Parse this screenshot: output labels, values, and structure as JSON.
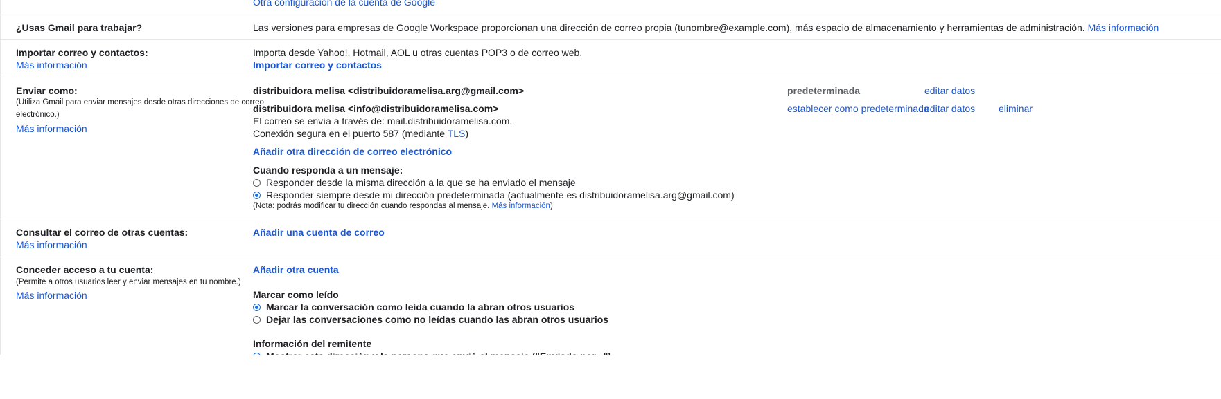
{
  "top_link": "Otra configuración de la cuenta de Google",
  "workspace": {
    "label": "¿Usas Gmail para trabajar?",
    "text": "Las versiones para empresas de Google Workspace proporcionan una dirección de correo propia (tunombre@example.com), más espacio de almacenamiento y herramientas de administración.",
    "more": "Más información"
  },
  "import": {
    "label": "Importar correo y contactos:",
    "more": "Más información",
    "text": "Importa desde Yahoo!, Hotmail, AOL u otras cuentas POP3 o de correo web.",
    "action": "Importar correo y contactos"
  },
  "send_as": {
    "label": "Enviar como:",
    "desc_line1": "(Utiliza Gmail para enviar mensajes desde otras direcciones de correo",
    "desc_line2": "electrónico.)",
    "more": "Más información",
    "addresses": [
      {
        "name": "distribuidora melisa <distribuidoramelisa.arg@gmail.com>",
        "status": "predeterminada",
        "edit": "editar datos"
      },
      {
        "name": "distribuidora melisa <info@distribuidoramelisa.com>",
        "set_default": "establecer como predeterminada",
        "edit": "editar datos",
        "delete": "eliminar",
        "server_line": "El correo se envía a través de: mail.distribuidoramelisa.com.",
        "secure_prefix": "Conexión segura en el puerto 587 (mediante ",
        "secure_link": "TLS",
        "secure_suffix": ")"
      }
    ],
    "add_address": "Añadir otra dirección de correo electrónico",
    "reply_heading": "Cuando responda a un mensaje:",
    "reply_options": [
      {
        "label": "Responder desde la misma dirección a la que se ha enviado el mensaje",
        "selected": false
      },
      {
        "label": "Responder siempre desde mi dirección predeterminada (actualmente es distribuidoramelisa.arg@gmail.com)",
        "selected": true
      }
    ],
    "note_prefix": "(Nota: podrás modificar tu dirección cuando respondas al mensaje.",
    "note_link": "Más información",
    "note_suffix": ")"
  },
  "check_mail": {
    "label": "Consultar el correo de otras cuentas:",
    "more": "Más información",
    "action": "Añadir una cuenta de correo"
  },
  "grant_access": {
    "label": "Conceder acceso a tu cuenta:",
    "desc": "(Permite a otros usuarios leer y enviar mensajes en tu nombre.)",
    "more": "Más información",
    "action": "Añadir otra cuenta",
    "mark_read_heading": "Marcar como leído",
    "mark_read_options": [
      {
        "label": "Marcar la conversación como leída cuando la abran otros usuarios",
        "selected": true
      },
      {
        "label": "Dejar las conversaciones como no leídas cuando las abran otros usuarios",
        "selected": false
      }
    ],
    "sender_info_heading": "Información del remitente",
    "sender_info_option_partial": "Mostrar esta dirección y la persona que envió el mensaje (\"Enviado por...\")"
  },
  "colors": {
    "link": "#1a57d6",
    "radio_selected": "#1a73e8",
    "divider": "#e6e6e6",
    "text": "#202124"
  }
}
